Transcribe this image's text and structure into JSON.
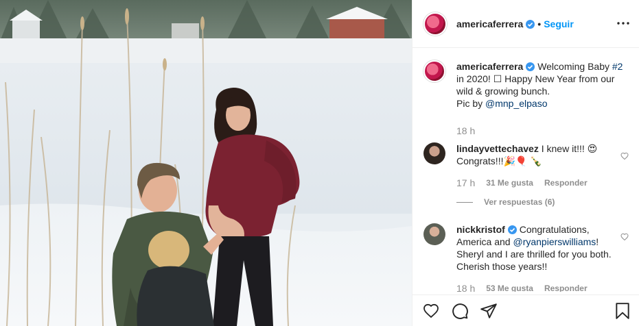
{
  "post": {
    "author": "americaferrera",
    "follow_label": "Seguir",
    "dot": "•",
    "caption": {
      "text": "Welcoming Baby ",
      "hashtag": "#2",
      "text2": " in 2020! ☐ Happy New Year from our wild & growing bunch.",
      "pic_by": "Pic by ",
      "mention": "@mnp_elpaso",
      "time": "18 h"
    }
  },
  "comments": [
    {
      "user": "lindayvettechavez",
      "text": " I knew it!!! 😍 Congrats!!!🎉🎈 🍾",
      "time": "17 h",
      "likes": "31 Me gusta",
      "reply": "Responder",
      "view_replies": "Ver respuestas (6)"
    },
    {
      "user": "nickkristof",
      "text_a": " Congratulations, America and ",
      "mention": "@ryanpierswilliams",
      "text_b": "! Sheryl and I are thrilled for you both. Cherish those years!!",
      "time": "18 h",
      "likes": "53 Me gusta",
      "reply": "Responder"
    }
  ],
  "icons": {
    "verified": "verified-badge-icon",
    "more": "more-options-icon",
    "like": "heart-icon",
    "comment": "comment-icon",
    "share": "send-icon",
    "save": "bookmark-icon"
  },
  "colors": {
    "accent": "#0095f6",
    "mention": "#00376b",
    "muted": "#8e8e8e",
    "sweater": "#7b2231"
  }
}
